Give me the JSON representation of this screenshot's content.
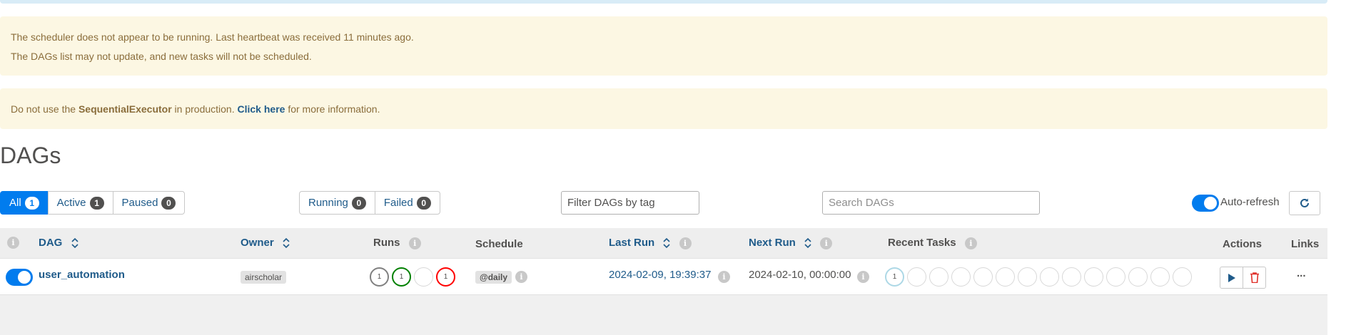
{
  "alerts": {
    "scheduler_line1": "The scheduler does not appear to be running. Last heartbeat was received 11 minutes ago.",
    "scheduler_line2": "The DAGs list may not update, and new tasks will not be scheduled.",
    "executor_prefix": "Do not use the ",
    "executor_name": "SequentialExecutor",
    "executor_middle": " in production. ",
    "executor_link": "Click here",
    "executor_suffix": " for more information."
  },
  "page_title": "DAGs",
  "filters": {
    "all": {
      "label": "All",
      "count": "1"
    },
    "active": {
      "label": "Active",
      "count": "1"
    },
    "paused": {
      "label": "Paused",
      "count": "0"
    },
    "running": {
      "label": "Running",
      "count": "0"
    },
    "failed": {
      "label": "Failed",
      "count": "0"
    },
    "selected": "All"
  },
  "tag_filter_placeholder": "Filter DAGs by tag",
  "search_placeholder": "Search DAGs",
  "auto_refresh": {
    "label": "Auto-refresh",
    "enabled": true
  },
  "table": {
    "headers": {
      "info": "i",
      "dag": "DAG",
      "owner": "Owner",
      "runs": "Runs",
      "schedule": "Schedule",
      "last_run": "Last Run",
      "next_run": "Next Run",
      "recent_tasks": "Recent Tasks",
      "actions": "Actions",
      "links": "Links"
    },
    "rows": [
      {
        "enabled": true,
        "dag_id": "user_automation",
        "owner": "airscholar",
        "runs": [
          "1",
          "1",
          "",
          "1"
        ],
        "schedule": "@daily",
        "last_run": "2024-02-09, 19:39:37",
        "next_run": "2024-02-10, 00:00:00",
        "recent_tasks": [
          "1",
          "",
          "",
          "",
          "",
          "",
          "",
          "",
          "",
          "",
          "",
          "",
          "",
          ""
        ],
        "links_label": "..."
      }
    ]
  },
  "colors": {
    "primary": "#017cee",
    "link": "#1f5b8a",
    "warning_bg": "#fcf7e3",
    "warning_text": "#8a6d3b",
    "run_queued": "#808080",
    "run_success": "#008000",
    "run_failed": "#ff0000",
    "task_queued": "#add8e6",
    "delete": "#e0312a"
  },
  "icons": {
    "sort": "sort-arrows-icon",
    "info": "info-icon",
    "refresh": "refresh-icon",
    "trigger": "play-icon",
    "delete": "trash-icon",
    "links": "ellipsis-icon"
  }
}
